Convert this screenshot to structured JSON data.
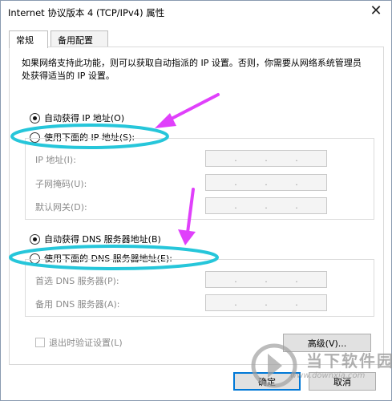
{
  "window": {
    "title": "Internet 协议版本 4 (TCP/IPv4) 属性",
    "close_glyph": "✕"
  },
  "tabs": [
    {
      "label": "常规",
      "active": true
    },
    {
      "label": "备用配置",
      "active": false
    }
  ],
  "description": "如果网络支持此功能，则可以获取自动指派的 IP 设置。否则，你需要从网络系统管理员处获得适当的 IP 设置。",
  "ip_section": {
    "auto_option": {
      "label": "自动获得 IP 地址(O)",
      "checked": true
    },
    "manual_option": {
      "label": "使用下面的 IP 地址(S):",
      "checked": false
    },
    "fields": [
      {
        "label": "IP 地址(I):",
        "value": ". . ."
      },
      {
        "label": "子网掩码(U):",
        "value": ". . ."
      },
      {
        "label": "默认网关(D):",
        "value": ". . ."
      }
    ]
  },
  "dns_section": {
    "auto_option": {
      "label": "自动获得 DNS 服务器地址(B)",
      "checked": true
    },
    "manual_option": {
      "label": "使用下面的 DNS 服务器地址(E):",
      "checked": false
    },
    "fields": [
      {
        "label": "首选 DNS 服务器(P):",
        "value": ". . ."
      },
      {
        "label": "备用 DNS 服务器(A):",
        "value": ". . ."
      }
    ]
  },
  "validate_on_exit": {
    "label": "退出时验证设置(L)",
    "checked": false
  },
  "buttons": {
    "advanced": "高级(V)...",
    "ok": "确定",
    "cancel": "取消"
  },
  "annotation_color": "#e040fb",
  "highlight_color": "#26c6da",
  "watermark": {
    "text": "当下软件园",
    "url": "www.downxia.com"
  }
}
